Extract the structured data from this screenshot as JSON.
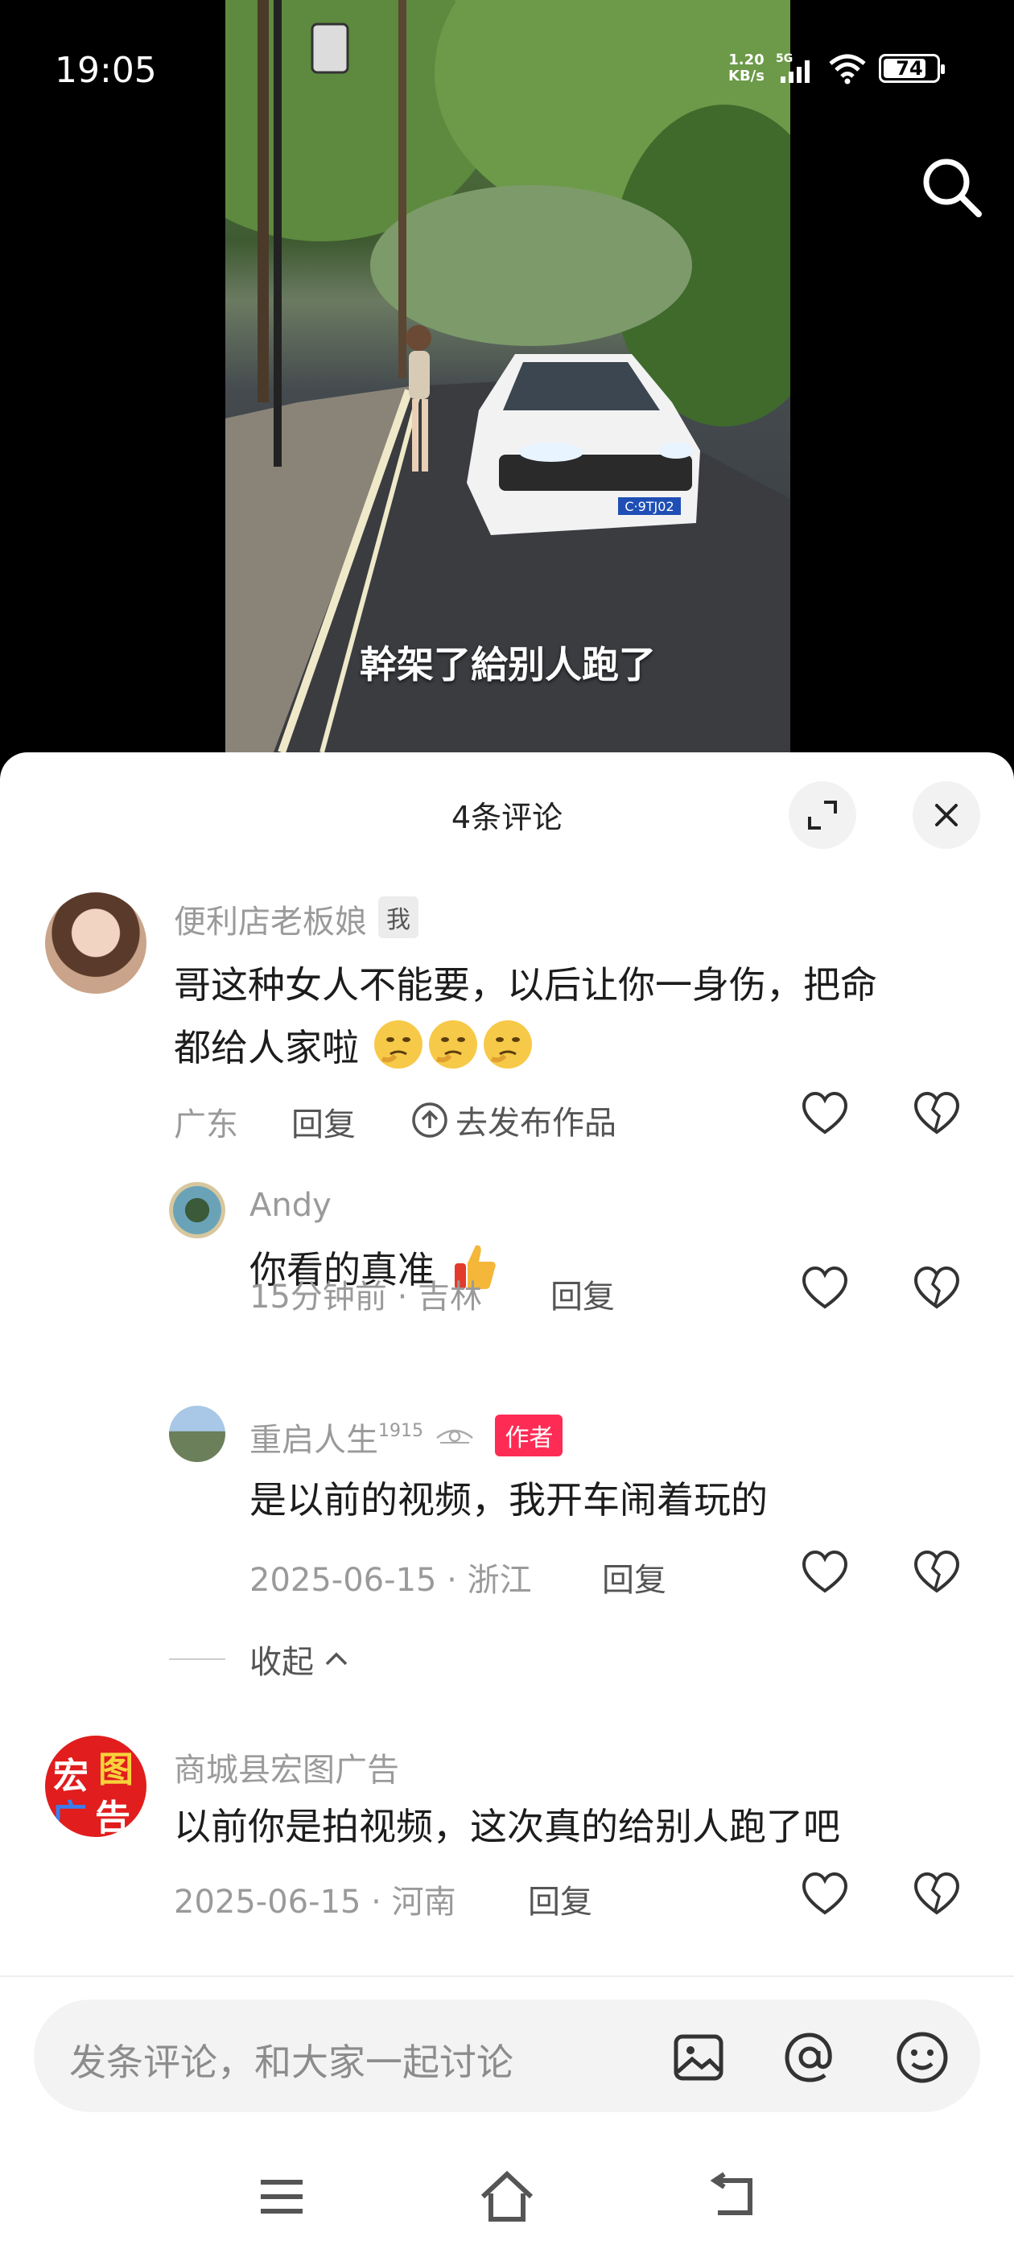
{
  "status_bar": {
    "time": "19:05",
    "net_speed_value": "1.20",
    "net_speed_unit": "KB/s",
    "network": "5G",
    "battery": "74"
  },
  "video": {
    "caption": "幹架了給别人跑了",
    "plate": "C·9TJ02"
  },
  "comments_panel": {
    "title": "4条评论",
    "comments": [
      {
        "user": "便利店老板娘",
        "badge": "我",
        "text_line1": "哥这种女人不能要，以后让你一身伤，把命",
        "text_line2": "都给人家啦",
        "location": "广东",
        "reply_label": "回复",
        "publish_label": "去发布作品"
      },
      {
        "user": "Andy",
        "text": "你看的真准",
        "meta": "15分钟前 · 吉林",
        "reply_label": "回复"
      },
      {
        "user": "重启人生",
        "user_suffix": "1915",
        "badge": "作者",
        "text": "是以前的视频，我开车闹着玩的",
        "meta": "2025-06-15 · 浙江",
        "reply_label": "回复"
      },
      {
        "user": "商城县宏图广告",
        "avatar_text": [
          "宏",
          "图",
          "广",
          "告"
        ],
        "text": "以前你是拍视频，这次真的给别人跑了吧",
        "meta": "2025-06-15 · 河南",
        "reply_label": "回复"
      }
    ],
    "collapse_label": "收起"
  },
  "input": {
    "placeholder": "发条评论，和大家一起讨论"
  },
  "colors": {
    "accent": "#fe2c55",
    "meta_gray": "#9a9a9a",
    "sheet_bg": "#ffffff"
  },
  "icons": {
    "search": "search-icon",
    "expand": "expand-icon",
    "close": "close-icon",
    "like": "heart-icon",
    "dislike": "broken-heart-icon",
    "image": "image-icon",
    "mention": "at-icon",
    "emoji": "emoji-icon"
  }
}
